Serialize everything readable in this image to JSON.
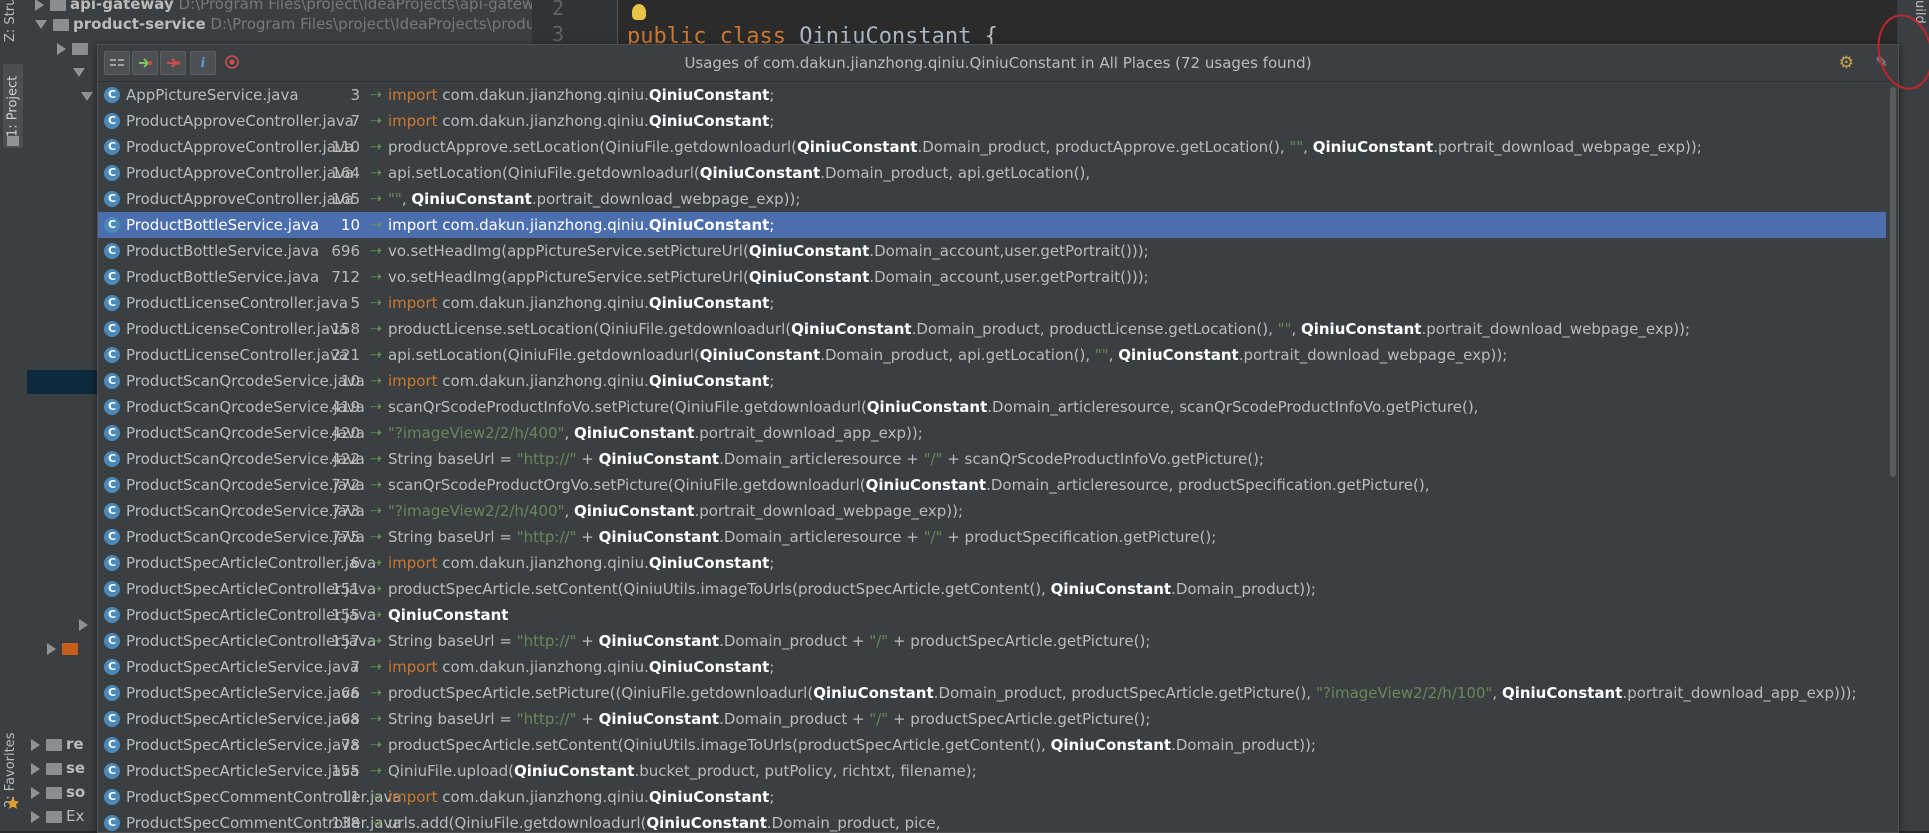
{
  "left_strip": {
    "structure_label": "Z: Structure",
    "project_label": "1: Project",
    "favorites_label": "2: Favorites"
  },
  "tree": {
    "rows": [
      {
        "name": "api-gateway",
        "path": "D:\\Program Files\\project\\IdeaProjects\\api-gatew"
      },
      {
        "name": "product-service",
        "path": "D:\\Program Files\\project\\IdeaProjects\\produ"
      },
      {
        "name": "re"
      },
      {
        "name": "se"
      },
      {
        "name": "so"
      },
      {
        "name": "Ex"
      }
    ]
  },
  "editor": {
    "line_numbers": [
      "2",
      "3"
    ],
    "keyword_public": "public",
    "keyword_class": "class",
    "class_name": "QiniuConstant",
    "brace": "{"
  },
  "right_strip": {
    "label": "uild"
  },
  "popup": {
    "title": "Usages of com.dakun.jianzhong.qiniu.QiniuConstant in All Places (72 usages found)",
    "toolbar": {
      "merge_icon": "merge-lines-icon",
      "read_icon": "read-access-icon",
      "write_icon": "write-access-icon",
      "info_icon": "info-icon",
      "module_icon": "module-icon"
    },
    "selected_index": 5,
    "rows": [
      {
        "file": "AppPictureService.java",
        "line": "3",
        "parts": [
          {
            "t": "import",
            "c": "k"
          },
          {
            "t": " com.dakun.jianzhong.qiniu."
          },
          {
            "t": "QiniuConstant",
            "c": "b"
          },
          {
            "t": ";"
          }
        ]
      },
      {
        "file": "ProductApproveController.java",
        "line": "7",
        "parts": [
          {
            "t": "import",
            "c": "k"
          },
          {
            "t": " com.dakun.jianzhong.qiniu."
          },
          {
            "t": "QiniuConstant",
            "c": "b"
          },
          {
            "t": ";"
          }
        ]
      },
      {
        "file": "ProductApproveController.java",
        "line": "110",
        "parts": [
          {
            "t": "productApprove.setLocation(QiniuFile.getdownloadurl("
          },
          {
            "t": "QiniuConstant",
            "c": "b"
          },
          {
            "t": ".Domain_product, productApprove.getLocation(), "
          },
          {
            "t": "\"\"",
            "c": "s"
          },
          {
            "t": ", "
          },
          {
            "t": "QiniuConstant",
            "c": "b"
          },
          {
            "t": ".portrait_download_webpage_exp));"
          }
        ]
      },
      {
        "file": "ProductApproveController.java",
        "line": "164",
        "parts": [
          {
            "t": "api.setLocation(QiniuFile.getdownloadurl("
          },
          {
            "t": "QiniuConstant",
            "c": "b"
          },
          {
            "t": ".Domain_product, api.getLocation(),"
          }
        ]
      },
      {
        "file": "ProductApproveController.java",
        "line": "165",
        "parts": [
          {
            "t": "\"\"",
            "c": "s"
          },
          {
            "t": ", "
          },
          {
            "t": "QiniuConstant",
            "c": "b"
          },
          {
            "t": ".portrait_download_webpage_exp));"
          }
        ]
      },
      {
        "file": "ProductBottleService.java",
        "line": "10",
        "parts": [
          {
            "t": "import",
            "c": "k"
          },
          {
            "t": " com.dakun.jianzhong.qiniu."
          },
          {
            "t": "QiniuConstant",
            "c": "b"
          },
          {
            "t": ";"
          }
        ]
      },
      {
        "file": "ProductBottleService.java",
        "line": "696",
        "parts": [
          {
            "t": "vo.setHeadImg(appPictureService.setPictureUrl("
          },
          {
            "t": "QiniuConstant",
            "c": "b"
          },
          {
            "t": ".Domain_account,user.getPortrait()));"
          }
        ]
      },
      {
        "file": "ProductBottleService.java",
        "line": "712",
        "parts": [
          {
            "t": "vo.setHeadImg(appPictureService.setPictureUrl("
          },
          {
            "t": "QiniuConstant",
            "c": "b"
          },
          {
            "t": ".Domain_account,user.getPortrait()));"
          }
        ]
      },
      {
        "file": "ProductLicenseController.java",
        "line": "5",
        "parts": [
          {
            "t": "import",
            "c": "k"
          },
          {
            "t": " com.dakun.jianzhong.qiniu."
          },
          {
            "t": "QiniuConstant",
            "c": "b"
          },
          {
            "t": ";"
          }
        ]
      },
      {
        "file": "ProductLicenseController.java",
        "line": "158",
        "parts": [
          {
            "t": "productLicense.setLocation(QiniuFile.getdownloadurl("
          },
          {
            "t": "QiniuConstant",
            "c": "b"
          },
          {
            "t": ".Domain_product, productLicense.getLocation(), "
          },
          {
            "t": "\"\"",
            "c": "s"
          },
          {
            "t": ", "
          },
          {
            "t": "QiniuConstant",
            "c": "b"
          },
          {
            "t": ".portrait_download_webpage_exp));"
          }
        ]
      },
      {
        "file": "ProductLicenseController.java",
        "line": "221",
        "parts": [
          {
            "t": "api.setLocation(QiniuFile.getdownloadurl("
          },
          {
            "t": "QiniuConstant",
            "c": "b"
          },
          {
            "t": ".Domain_product, api.getLocation(), "
          },
          {
            "t": "\"\"",
            "c": "s"
          },
          {
            "t": ", "
          },
          {
            "t": "QiniuConstant",
            "c": "b"
          },
          {
            "t": ".portrait_download_webpage_exp));"
          }
        ]
      },
      {
        "file": "ProductScanQrcodeService.java",
        "line": "10",
        "parts": [
          {
            "t": "import",
            "c": "k"
          },
          {
            "t": " com.dakun.jianzhong.qiniu."
          },
          {
            "t": "QiniuConstant",
            "c": "b"
          },
          {
            "t": ";"
          }
        ]
      },
      {
        "file": "ProductScanQrcodeService.java",
        "line": "419",
        "parts": [
          {
            "t": "scanQrScodeProductInfoVo.setPicture(QiniuFile.getdownloadurl("
          },
          {
            "t": "QiniuConstant",
            "c": "b"
          },
          {
            "t": ".Domain_articleresource, scanQrScodeProductInfoVo.getPicture(),"
          }
        ]
      },
      {
        "file": "ProductScanQrcodeService.java",
        "line": "420",
        "parts": [
          {
            "t": "\"?imageView2/2/h/400\"",
            "c": "s"
          },
          {
            "t": ", "
          },
          {
            "t": "QiniuConstant",
            "c": "b"
          },
          {
            "t": ".portrait_download_app_exp));"
          }
        ]
      },
      {
        "file": "ProductScanQrcodeService.java",
        "line": "422",
        "parts": [
          {
            "t": "String baseUrl = "
          },
          {
            "t": "\"http://\"",
            "c": "s"
          },
          {
            "t": " + "
          },
          {
            "t": "QiniuConstant",
            "c": "b"
          },
          {
            "t": ".Domain_articleresource + "
          },
          {
            "t": "\"/\"",
            "c": "s"
          },
          {
            "t": " + scanQrScodeProductInfoVo.getPicture();"
          }
        ]
      },
      {
        "file": "ProductScanQrcodeService.java",
        "line": "772",
        "parts": [
          {
            "t": "scanQrScodeProductOrgVo.setPicture(QiniuFile.getdownloadurl("
          },
          {
            "t": "QiniuConstant",
            "c": "b"
          },
          {
            "t": ".Domain_articleresource, productSpecification.getPicture(),"
          }
        ]
      },
      {
        "file": "ProductScanQrcodeService.java",
        "line": "773",
        "parts": [
          {
            "t": "\"?imageView2/2/h/400\"",
            "c": "s"
          },
          {
            "t": ", "
          },
          {
            "t": "QiniuConstant",
            "c": "b"
          },
          {
            "t": ".portrait_download_webpage_exp));"
          }
        ]
      },
      {
        "file": "ProductScanQrcodeService.java",
        "line": "775",
        "parts": [
          {
            "t": "String baseUrl = "
          },
          {
            "t": "\"http://\"",
            "c": "s"
          },
          {
            "t": " + "
          },
          {
            "t": "QiniuConstant",
            "c": "b"
          },
          {
            "t": ".Domain_articleresource + "
          },
          {
            "t": "\"/\"",
            "c": "s"
          },
          {
            "t": " + productSpecification.getPicture();"
          }
        ]
      },
      {
        "file": "ProductSpecArticleController.java",
        "line": "6",
        "parts": [
          {
            "t": "import",
            "c": "k"
          },
          {
            "t": " com.dakun.jianzhong.qiniu."
          },
          {
            "t": "QiniuConstant",
            "c": "b"
          },
          {
            "t": ";"
          }
        ]
      },
      {
        "file": "ProductSpecArticleController.java",
        "line": "151",
        "parts": [
          {
            "t": "productSpecArticle.setContent(QiniuUtils.imageToUrls(productSpecArticle.getContent(), "
          },
          {
            "t": "QiniuConstant",
            "c": "b"
          },
          {
            "t": ".Domain_product));"
          }
        ]
      },
      {
        "file": "ProductSpecArticleController.java",
        "line": "155",
        "parts": [
          {
            "t": "QiniuConstant",
            "c": "b"
          }
        ]
      },
      {
        "file": "ProductSpecArticleController.java",
        "line": "157",
        "parts": [
          {
            "t": "String baseUrl = "
          },
          {
            "t": "\"http://\"",
            "c": "s"
          },
          {
            "t": " + "
          },
          {
            "t": "QiniuConstant",
            "c": "b"
          },
          {
            "t": ".Domain_product + "
          },
          {
            "t": "\"/\"",
            "c": "s"
          },
          {
            "t": " + productSpecArticle.getPicture();"
          }
        ]
      },
      {
        "file": "ProductSpecArticleService.java",
        "line": "7",
        "parts": [
          {
            "t": "import",
            "c": "k"
          },
          {
            "t": " com.dakun.jianzhong.qiniu."
          },
          {
            "t": "QiniuConstant",
            "c": "b"
          },
          {
            "t": ";"
          }
        ]
      },
      {
        "file": "ProductSpecArticleService.java",
        "line": "66",
        "parts": [
          {
            "t": "productSpecArticle.setPicture((QiniuFile.getdownloadurl("
          },
          {
            "t": "QiniuConstant",
            "c": "b"
          },
          {
            "t": ".Domain_product, productSpecArticle.getPicture(), "
          },
          {
            "t": "\"?imageView2/2/h/100\"",
            "c": "s"
          },
          {
            "t": ", "
          },
          {
            "t": "QiniuConstant",
            "c": "b"
          },
          {
            "t": ".portrait_download_app_exp)));"
          }
        ]
      },
      {
        "file": "ProductSpecArticleService.java",
        "line": "68",
        "parts": [
          {
            "t": "String baseUrl = "
          },
          {
            "t": "\"http://\"",
            "c": "s"
          },
          {
            "t": " + "
          },
          {
            "t": "QiniuConstant",
            "c": "b"
          },
          {
            "t": ".Domain_product + "
          },
          {
            "t": "\"/\"",
            "c": "s"
          },
          {
            "t": " + productSpecArticle.getPicture();"
          }
        ]
      },
      {
        "file": "ProductSpecArticleService.java",
        "line": "78",
        "parts": [
          {
            "t": "productSpecArticle.setContent(QiniuUtils.imageToUrls(productSpecArticle.getContent(), "
          },
          {
            "t": "QiniuConstant",
            "c": "b"
          },
          {
            "t": ".Domain_product));"
          }
        ]
      },
      {
        "file": "ProductSpecArticleService.java",
        "line": "155",
        "parts": [
          {
            "t": "QiniuFile.upload("
          },
          {
            "t": "QiniuConstant",
            "c": "b"
          },
          {
            "t": ".bucket_product, putPolicy, richtxt, filename);"
          }
        ]
      },
      {
        "file": "ProductSpecCommentController.java",
        "line": "11",
        "parts": [
          {
            "t": "import",
            "c": "k"
          },
          {
            "t": " com.dakun.jianzhong.qiniu."
          },
          {
            "t": "QiniuConstant",
            "c": "b"
          },
          {
            "t": ";"
          }
        ]
      },
      {
        "file": "ProductSpecCommentController.java",
        "line": "138",
        "parts": [
          {
            "t": "urls.add(QiniuFile.getdownloadurl("
          },
          {
            "t": "QiniuConstant",
            "c": "b"
          },
          {
            "t": ".Domain_product, pice,"
          }
        ]
      }
    ]
  }
}
